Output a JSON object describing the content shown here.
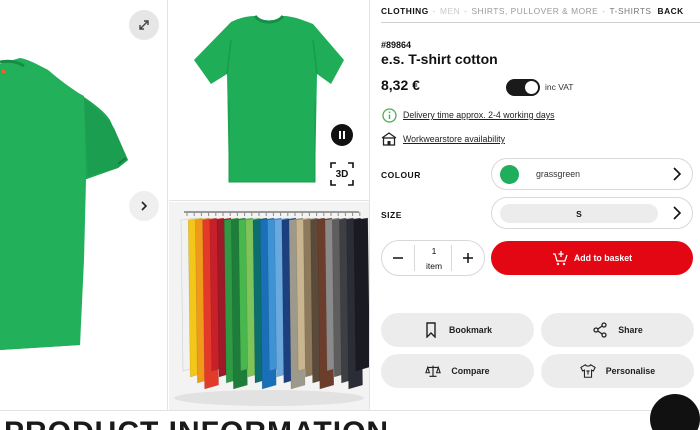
{
  "breadcrumb": {
    "items": [
      "CLOTHING",
      "MEN",
      "SHIRTS, PULLOVER & MORE",
      "T-SHIRTS"
    ],
    "back": "BACK"
  },
  "product": {
    "sku": "#89864",
    "title": "e.s. T-shirt cotton",
    "price": "8,32 €",
    "vat_label": "inc VAT",
    "vat_included": true
  },
  "info": {
    "delivery": "Delivery time approx. 2-4 working days",
    "store": "Workwearstore availability"
  },
  "options": {
    "colour_label": "COLOUR",
    "colour_value": "grassgreen",
    "colour_hex": "#1fae5b",
    "size_label": "SIZE",
    "size_value": "S"
  },
  "quantity": {
    "value": "1",
    "unit": "item"
  },
  "actions": {
    "basket": "Add to basket",
    "bookmark": "Bookmark",
    "share": "Share",
    "compare": "Compare",
    "personalise": "Personalise"
  },
  "gallery": {
    "badge_3d": "3D"
  },
  "bottom": {
    "heading": "PRODUCT INFORMATION"
  },
  "colors": {
    "accent": "#e30613",
    "product_green": "#1fae5b"
  },
  "icons": [
    "expand-icon",
    "arrow-right-icon",
    "pause-icon",
    "3d-view-icon",
    "info-icon",
    "store-icon",
    "chevron-right-icon",
    "minus-icon",
    "plus-icon",
    "basket-icon",
    "bookmark-icon",
    "share-icon",
    "compare-icon",
    "personalise-icon"
  ]
}
